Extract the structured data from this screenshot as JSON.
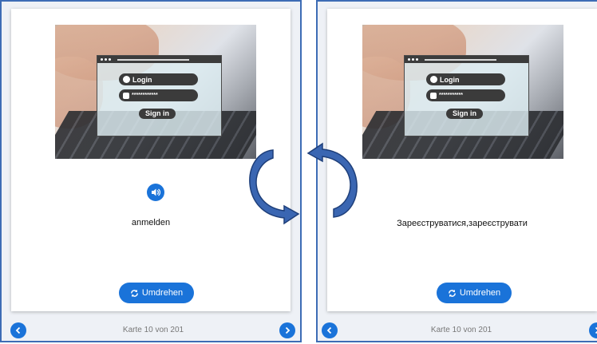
{
  "colors": {
    "accent": "#1a73d9",
    "panel_border": "#3d6cb5",
    "arrow_fill": "#3a66b2"
  },
  "left_card": {
    "image": {
      "login_label": "Login",
      "password_mask": "************",
      "signin_label": "Sign in"
    },
    "audio_icon": "speaker-icon",
    "word": "anmelden",
    "flip_label": "Umdrehen",
    "flip_icon": "refresh-icon",
    "counter": "Karte 10 von 201"
  },
  "right_card": {
    "image": {
      "login_label": "Login",
      "password_mask": "***********",
      "signin_label": "Sign in"
    },
    "word": "Зареєструватися,зареєструвати",
    "flip_label": "Umdrehen",
    "flip_icon": "refresh-icon",
    "counter": "Karte 10 von 201"
  }
}
